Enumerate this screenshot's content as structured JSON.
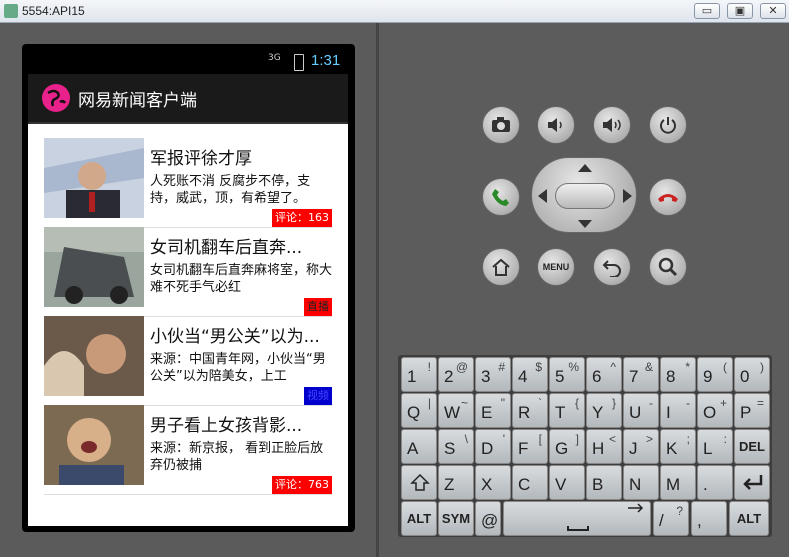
{
  "window": {
    "title": "5554:API15",
    "min_label": "▭",
    "max_label": "▣",
    "close_label": "✕"
  },
  "status": {
    "network": "3G",
    "time": "1:31"
  },
  "app": {
    "title": "网易新闻客户端"
  },
  "news": [
    {
      "title": "军报评徐才厚",
      "desc": "人死账不消 反腐步不停，支持，威武，顶，有希望了。",
      "badge": "评论：163",
      "badge_color": "#ff0000",
      "thumb_color": "#8fa3c4"
    },
    {
      "title": "女司机翻车后直奔...",
      "desc": "女司机翻车后直奔麻将室，称大难不死手气必红",
      "badge": "直播",
      "badge_color": "#ff0000",
      "thumb_color": "#7d8a82"
    },
    {
      "title": "小伙当“男公关”以为...",
      "desc": "来源：中国青年网，小伙当“男公关”以为陪美女，上工",
      "badge": "视频",
      "badge_color": "#0000cc",
      "thumb_color": "#9a6f5a"
    },
    {
      "title": "男子看上女孩背影...",
      "desc": " 来源：新京报， 看到正脸后放弃仍被捕",
      "badge": "评论：763",
      "badge_color": "#ff0000",
      "thumb_color": "#8b7a60"
    }
  ],
  "controls": {
    "camera": "camera",
    "vol_down": "volume-down",
    "vol_up": "volume-up",
    "power": "power",
    "call": "call",
    "end": "end-call",
    "home": "home",
    "menu": "MENU",
    "back": "back",
    "search": "search"
  },
  "keyboard": {
    "row1": [
      [
        "1",
        "!"
      ],
      [
        "2",
        "@"
      ],
      [
        "3",
        "#"
      ],
      [
        "4",
        "$"
      ],
      [
        "5",
        "%"
      ],
      [
        "6",
        "^"
      ],
      [
        "7",
        "&"
      ],
      [
        "8",
        "*"
      ],
      [
        "9",
        "("
      ],
      [
        "0",
        ")"
      ]
    ],
    "row2": [
      [
        "Q",
        "|"
      ],
      [
        "W",
        "~"
      ],
      [
        "E",
        "\""
      ],
      [
        "R",
        "`"
      ],
      [
        "T",
        "{"
      ],
      [
        "Y",
        "}"
      ],
      [
        "U",
        "-"
      ],
      [
        "I",
        "-"
      ],
      [
        "O",
        "+"
      ],
      [
        "P",
        "="
      ]
    ],
    "row3": [
      [
        "A",
        ""
      ],
      [
        "S",
        "\\"
      ],
      [
        "D",
        "'"
      ],
      [
        "F",
        "["
      ],
      [
        "G",
        "]"
      ],
      [
        "H",
        "<"
      ],
      [
        "J",
        ">"
      ],
      [
        "K",
        ";"
      ],
      [
        "L",
        ":"
      ]
    ],
    "row4": [
      [
        "Z",
        ""
      ],
      [
        "X",
        ""
      ],
      [
        "C",
        ""
      ],
      [
        "V",
        ""
      ],
      [
        "B",
        ""
      ],
      [
        "N",
        ""
      ],
      [
        "M",
        ""
      ],
      [
        ".",
        ""
      ]
    ],
    "del": "DEL",
    "alt": "ALT",
    "sym": "SYM",
    "at": "@",
    "slash": "/",
    "question": "?",
    "comma": ","
  }
}
